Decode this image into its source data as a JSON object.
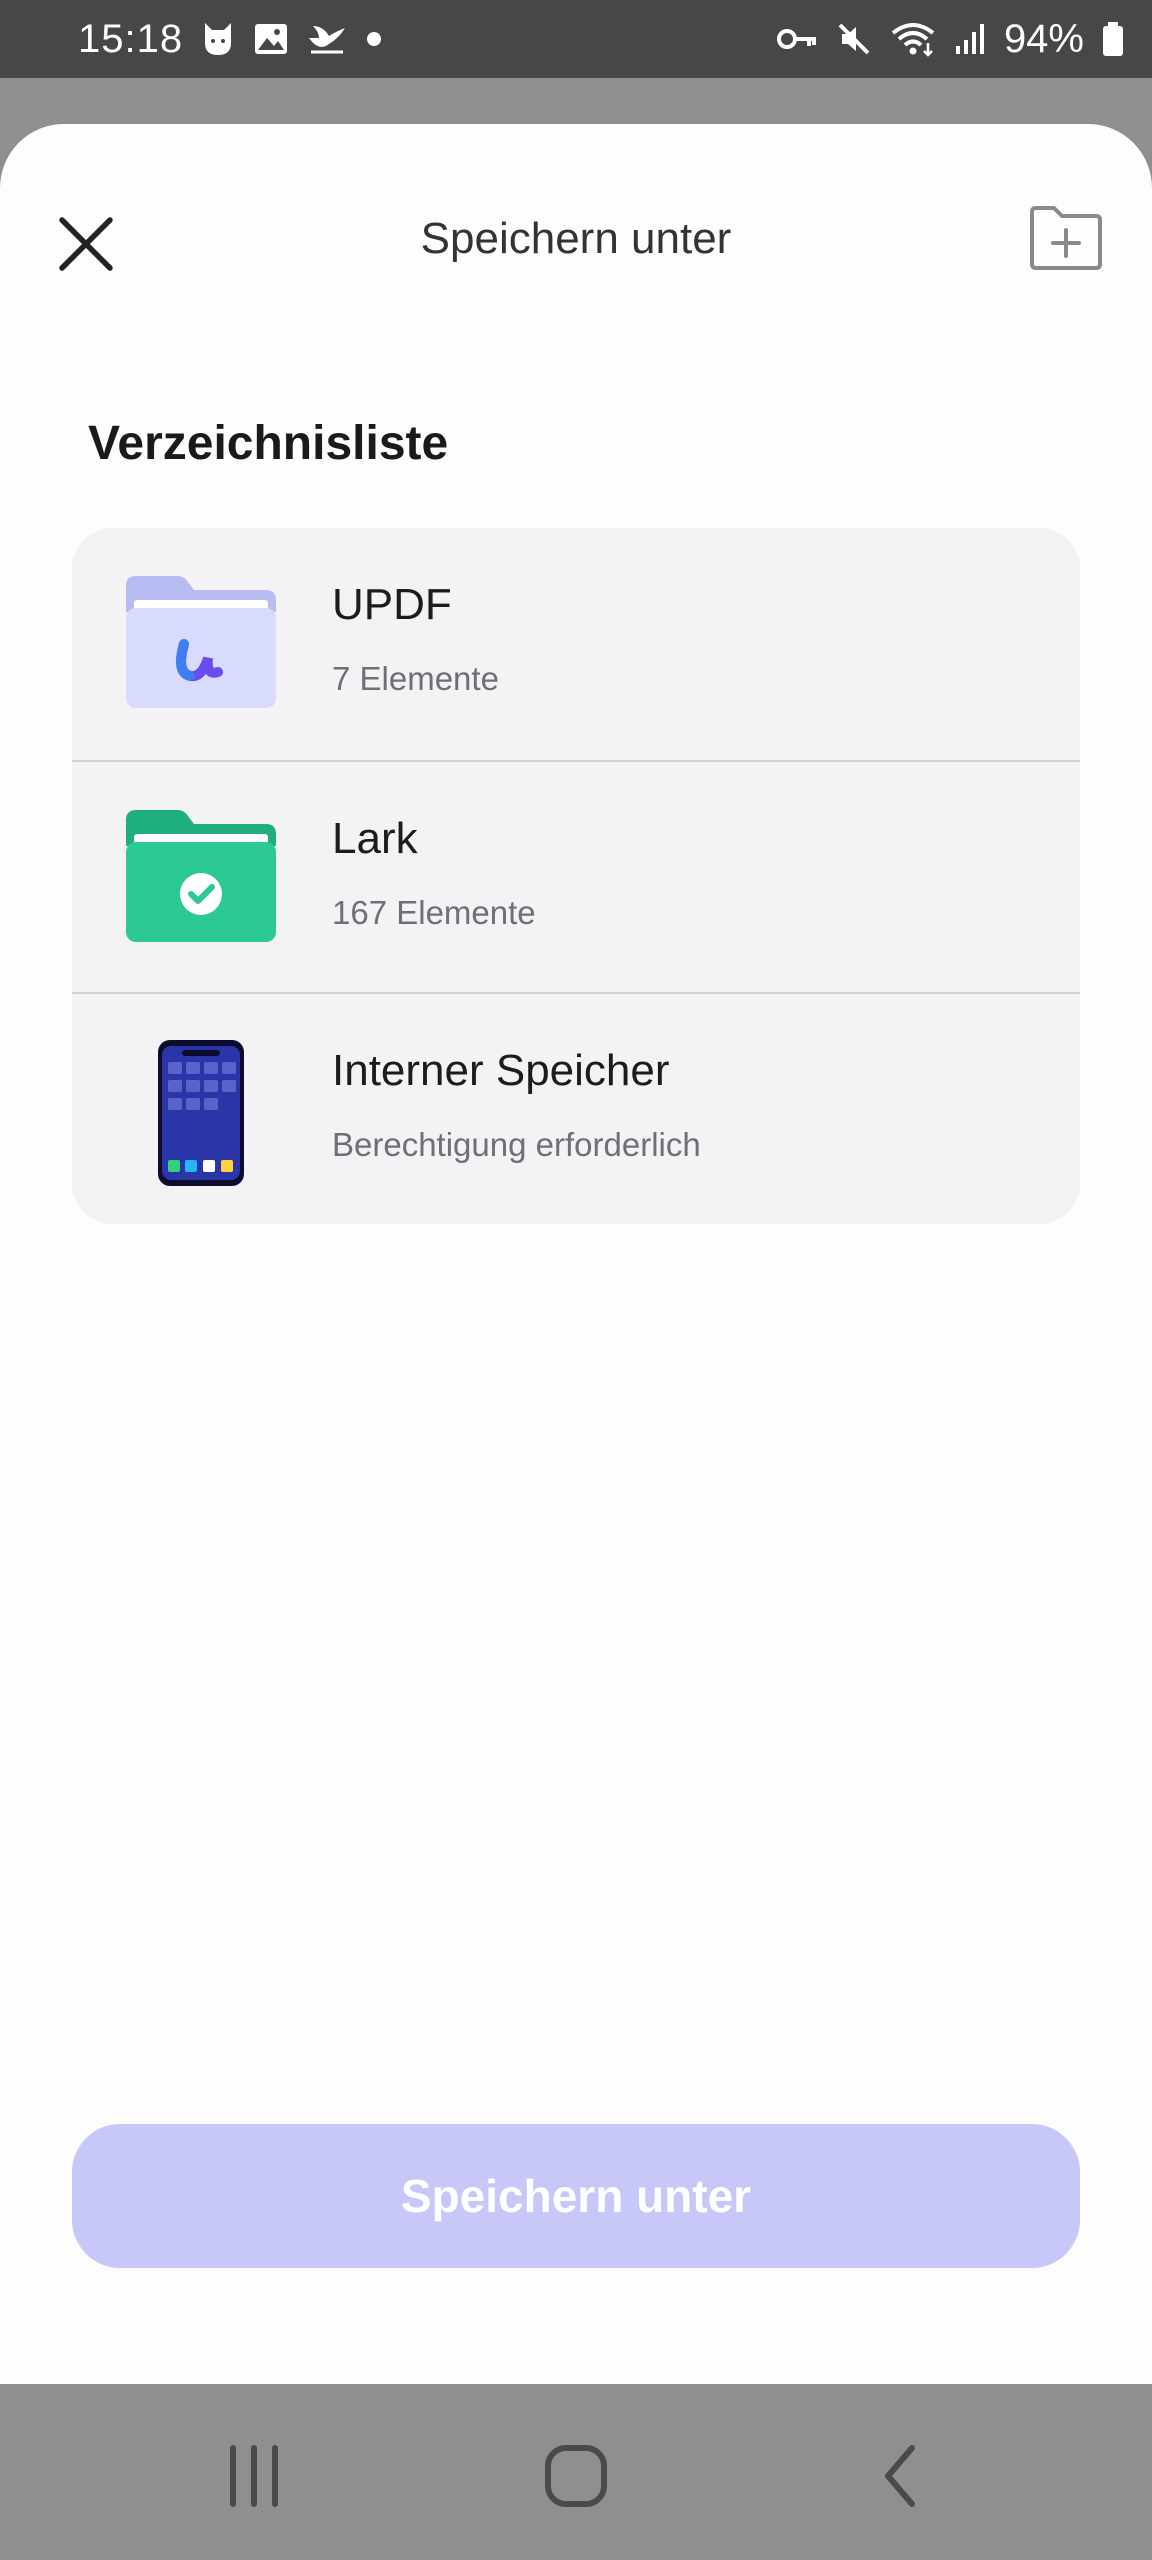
{
  "status_bar": {
    "time": "15:18",
    "battery_text": "94%",
    "left_icons": [
      "cat-notification-icon",
      "gallery-icon",
      "bird-notification-icon",
      "dot-icon"
    ],
    "right_icons": [
      "key-icon",
      "mute-icon",
      "wifi-icon",
      "signal-icon",
      "battery-icon"
    ]
  },
  "sheet": {
    "title": "Speichern unter",
    "close_icon": "close-icon",
    "new_folder_icon": "new-folder-icon"
  },
  "directory": {
    "section_title": "Verzeichnisliste",
    "items": [
      {
        "name": "UPDF",
        "subtitle": "7 Elemente",
        "icon": "updf-folder-icon"
      },
      {
        "name": "Lark",
        "subtitle": "167 Elemente",
        "icon": "lark-folder-icon"
      },
      {
        "name": "Interner Speicher",
        "subtitle": "Berechtigung erforderlich",
        "icon": "phone-storage-icon"
      }
    ]
  },
  "actions": {
    "save_label": "Speichern unter"
  },
  "nav_bar": {
    "items": [
      "recent-apps-icon",
      "home-icon",
      "back-icon"
    ]
  },
  "colors": {
    "status_bar": "#474747",
    "sheet_background": "#fdfdfe",
    "list_background": "#f3f3f6",
    "save_button": "#c7c7f8",
    "scrim": "#8f8f8f"
  }
}
